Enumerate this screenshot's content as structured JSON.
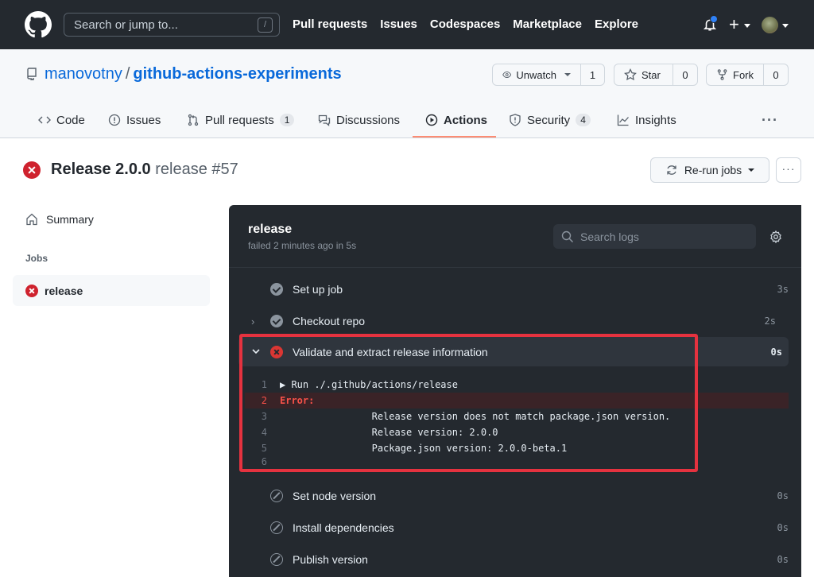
{
  "topbar": {
    "search_placeholder": "Search or jump to...",
    "search_shortcut": "/",
    "nav": [
      "Pull requests",
      "Issues",
      "Codespaces",
      "Marketplace",
      "Explore"
    ],
    "notification_indicator_color": "#2f81f7"
  },
  "repo": {
    "owner": "manovotny",
    "separator": "/",
    "name": "github-actions-experiments",
    "watch": {
      "label": "Unwatch",
      "count": "1"
    },
    "star": {
      "label": "Star",
      "count": "0"
    },
    "fork": {
      "label": "Fork",
      "count": "0"
    }
  },
  "tabs": [
    {
      "label": "Code"
    },
    {
      "label": "Issues"
    },
    {
      "label": "Pull requests",
      "badge": "1"
    },
    {
      "label": "Discussions"
    },
    {
      "label": "Actions",
      "active": true
    },
    {
      "label": "Security",
      "badge": "4"
    },
    {
      "label": "Insights"
    }
  ],
  "run": {
    "title": "Release 2.0.0",
    "subtitle": "release #57",
    "status": "failed",
    "rerun_label": "Re-run jobs",
    "more_label": "···"
  },
  "sidebar": {
    "summary_label": "Summary",
    "jobs_heading": "Jobs",
    "jobs": [
      {
        "label": "release",
        "status": "failed"
      }
    ]
  },
  "job": {
    "title": "release",
    "subtitle": "failed 2 minutes ago in 5s",
    "search_placeholder": "Search logs",
    "steps": [
      {
        "label": "Set up job",
        "duration": "3s",
        "status": "success"
      },
      {
        "label": "Checkout repo",
        "duration": "2s",
        "status": "success"
      },
      {
        "label": "Validate and extract release information",
        "duration": "0s",
        "status": "failed",
        "expanded": true
      },
      {
        "label": "Set node version",
        "duration": "0s",
        "status": "skipped"
      },
      {
        "label": "Install dependencies",
        "duration": "0s",
        "status": "skipped"
      },
      {
        "label": "Publish version",
        "duration": "0s",
        "status": "skipped"
      }
    ],
    "log_lines": [
      {
        "n": "1",
        "text": "▶ Run ./.github/actions/release"
      },
      {
        "n": "2",
        "text": "Error:",
        "error": true
      },
      {
        "n": "3",
        "text": "                Release version does not match package.json version."
      },
      {
        "n": "4",
        "text": "                Release version: 2.0.0"
      },
      {
        "n": "5",
        "text": "                Package.json version: 2.0.0-beta.1"
      },
      {
        "n": "6",
        "text": ""
      }
    ]
  },
  "annotation": {
    "highlight_color": "#e5323f"
  }
}
